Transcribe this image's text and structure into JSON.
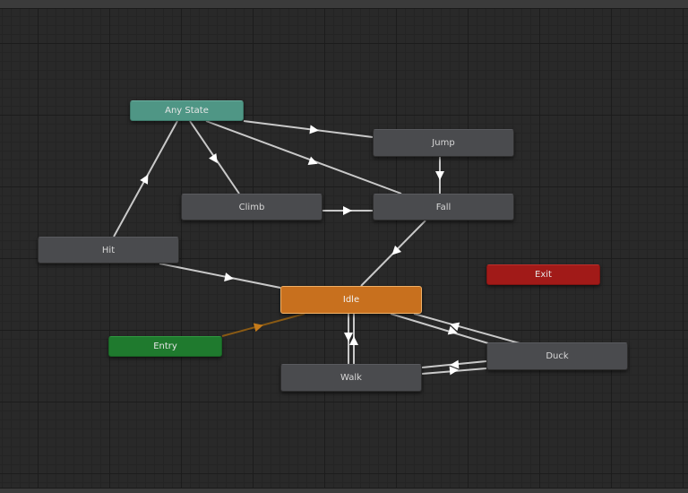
{
  "window": {
    "title": ""
  },
  "states": {
    "any_state": "Any State",
    "jump": "Jump",
    "climb": "Climb",
    "fall": "Fall",
    "hit": "Hit",
    "idle": "Idle",
    "exit": "Exit",
    "entry": "Entry",
    "duck": "Duck",
    "walk": "Walk"
  },
  "transitions": [
    {
      "from": "Any State",
      "to": "Jump"
    },
    {
      "from": "Any State",
      "to": "Fall"
    },
    {
      "from": "Any State",
      "to": "Climb"
    },
    {
      "from": "Hit",
      "to": "Any State"
    },
    {
      "from": "Jump",
      "to": "Fall"
    },
    {
      "from": "Climb",
      "to": "Fall"
    },
    {
      "from": "Fall",
      "to": "Idle"
    },
    {
      "from": "Hit",
      "to": "Idle"
    },
    {
      "from": "Entry",
      "to": "Idle"
    },
    {
      "from": "Idle",
      "to": "Walk"
    },
    {
      "from": "Walk",
      "to": "Idle"
    },
    {
      "from": "Idle",
      "to": "Duck"
    },
    {
      "from": "Duck",
      "to": "Idle"
    },
    {
      "from": "Walk",
      "to": "Duck"
    },
    {
      "from": "Duck",
      "to": "Walk"
    }
  ],
  "colors": {
    "any_state": "#4f9685",
    "entry": "#1f7a2e",
    "exit": "#a11a18",
    "default_state": "#c8701e",
    "state": "#4a4b4e",
    "transition": "#c9c9c9",
    "entry_transition": "#8a5a14"
  }
}
